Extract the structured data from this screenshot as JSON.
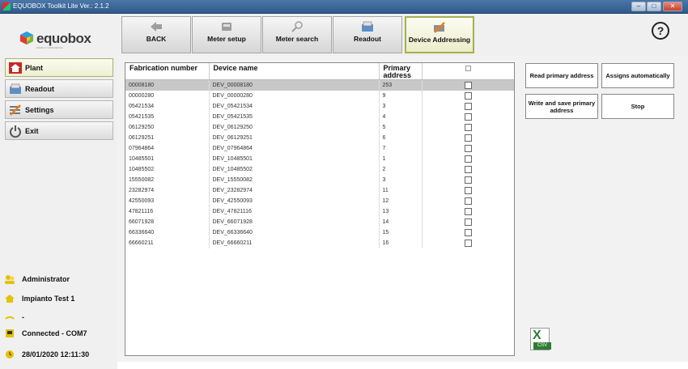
{
  "window": {
    "title": "EQUOBOX Toolkit Lite Ver.: 2.1.2",
    "minimize_icon": "minimize-icon",
    "maximize_icon": "maximize-icon",
    "close_icon": "close-icon"
  },
  "logo": {
    "text": "equobox",
    "tagline": "ENERGY EXPERIENCE"
  },
  "sidebar": {
    "items": [
      {
        "label": "Plant",
        "icon": "home-icon",
        "active": true
      },
      {
        "label": "Readout",
        "icon": "readout-icon",
        "active": false
      },
      {
        "label": "Settings",
        "icon": "settings-icon",
        "active": false
      },
      {
        "label": "Exit",
        "icon": "power-icon",
        "active": false
      }
    ]
  },
  "status": {
    "user": "Administrator",
    "plant": "Impianto Test 1",
    "signal": "-",
    "connection": "Connected - COM7",
    "datetime": "28/01/2020 12:11:30"
  },
  "toolbar": {
    "buttons": [
      {
        "label": "BACK",
        "icon": "back-arrow-icon"
      },
      {
        "label": "Meter setup",
        "icon": "meter-setup-icon"
      },
      {
        "label": "Meter search",
        "icon": "search-icon"
      },
      {
        "label": "Readout",
        "icon": "readout-icon"
      },
      {
        "label": "Device Addressing",
        "icon": "addressing-icon",
        "active": true
      }
    ],
    "help_label": "?"
  },
  "table": {
    "headers": {
      "fabrication": "Fabrication number",
      "device": "Device name",
      "primary": "Primary address"
    },
    "rows": [
      {
        "fab": "00008180",
        "name": "DEV_00008180",
        "addr": "253",
        "selected": true
      },
      {
        "fab": "00000280",
        "name": "DEV_00000280",
        "addr": "9"
      },
      {
        "fab": "05421534",
        "name": "DEV_05421534",
        "addr": "3"
      },
      {
        "fab": "05421535",
        "name": "DEV_05421535",
        "addr": "4"
      },
      {
        "fab": "06129250",
        "name": "DEV_06129250",
        "addr": "5"
      },
      {
        "fab": "06129251",
        "name": "DEV_06129251",
        "addr": "6"
      },
      {
        "fab": "07964864",
        "name": "DEV_07964864",
        "addr": "7"
      },
      {
        "fab": "10485501",
        "name": "DEV_10485501",
        "addr": "1"
      },
      {
        "fab": "10485502",
        "name": "DEV_10485502",
        "addr": "2"
      },
      {
        "fab": "15550082",
        "name": "DEV_15550082",
        "addr": "3"
      },
      {
        "fab": "23282974",
        "name": "DEV_23282974",
        "addr": "11"
      },
      {
        "fab": "42550093",
        "name": "DEV_42550093",
        "addr": "12"
      },
      {
        "fab": "47821116",
        "name": "DEV_47821116",
        "addr": "13"
      },
      {
        "fab": "66071928",
        "name": "DEV_66071928",
        "addr": "14"
      },
      {
        "fab": "66336640",
        "name": "DEV_66336640",
        "addr": "15"
      },
      {
        "fab": "66660211",
        "name": "DEV_66660211",
        "addr": "16"
      }
    ]
  },
  "actions": {
    "read_primary": "Read primary address",
    "assign_auto": "Assigns automatically",
    "write_save": "Write and save primary address",
    "stop": "Stop"
  },
  "export": {
    "csv_label": "CSV",
    "icon": "excel-csv-icon"
  }
}
